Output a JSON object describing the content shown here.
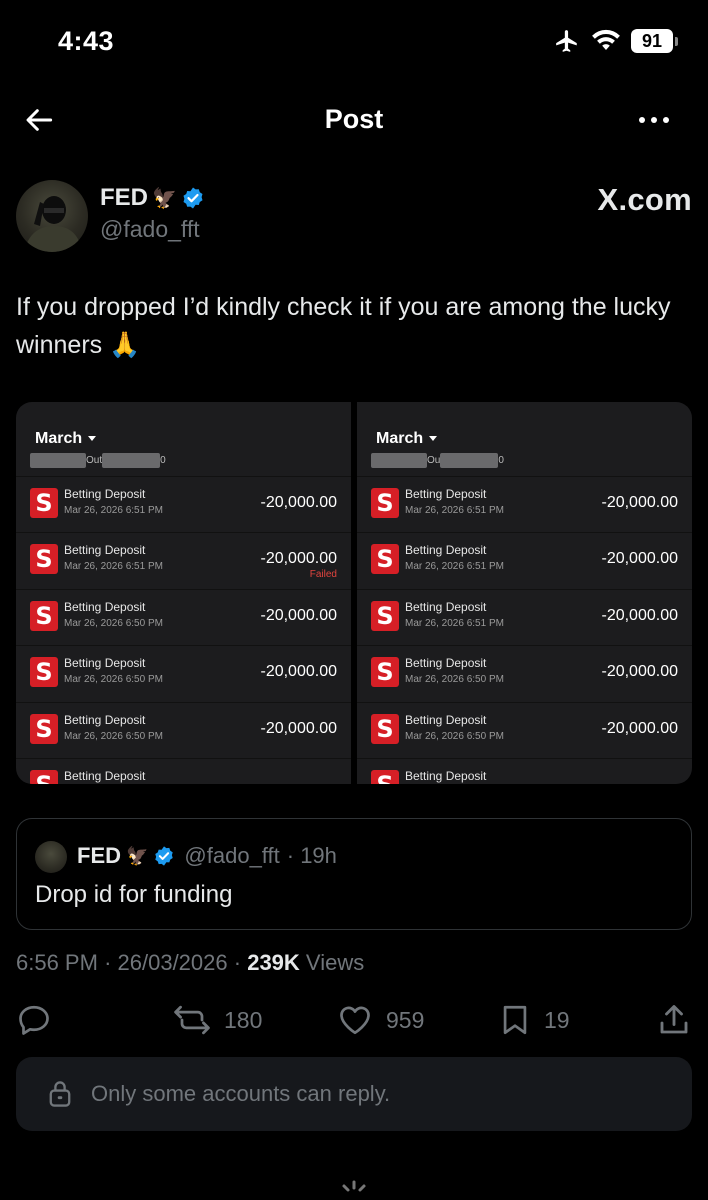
{
  "status": {
    "time": "4:43",
    "battery": "91"
  },
  "nav": {
    "title": "Post"
  },
  "author": {
    "name": "FED",
    "name_emoji": "🦅",
    "handle": "@fado_fft",
    "watermark": "X.com"
  },
  "post": {
    "text": "If you dropped I’d kindly check it if you are among the lucky winners 🙏"
  },
  "media": {
    "screenshots": [
      {
        "month": "March",
        "sub_left": "Out",
        "sub_right": "0",
        "transactions": [
          {
            "title": "Betting Deposit",
            "date": "Mar 26, 2026 6:51 PM",
            "amount": "-20,000.00",
            "status": ""
          },
          {
            "title": "Betting Deposit",
            "date": "Mar 26, 2026 6:51 PM",
            "amount": "-20,000.00",
            "status": "Failed"
          },
          {
            "title": "Betting Deposit",
            "date": "Mar 26, 2026 6:50 PM",
            "amount": "-20,000.00",
            "status": ""
          },
          {
            "title": "Betting Deposit",
            "date": "Mar 26, 2026 6:50 PM",
            "amount": "-20,000.00",
            "status": ""
          },
          {
            "title": "Betting Deposit",
            "date": "Mar 26, 2026 6:50 PM",
            "amount": "-20,000.00",
            "status": ""
          },
          {
            "title": "Betting Deposit",
            "date": "",
            "amount": "",
            "status": ""
          }
        ]
      },
      {
        "month": "March",
        "sub_left": "Ou",
        "sub_right": "0",
        "transactions": [
          {
            "title": "Betting Deposit",
            "date": "Mar 26, 2026 6:51 PM",
            "amount": "-20,000.00",
            "status": ""
          },
          {
            "title": "Betting Deposit",
            "date": "Mar 26, 2026 6:51 PM",
            "amount": "-20,000.00",
            "status": ""
          },
          {
            "title": "Betting Deposit",
            "date": "Mar 26, 2026 6:51 PM",
            "amount": "-20,000.00",
            "status": ""
          },
          {
            "title": "Betting Deposit",
            "date": "Mar 26, 2026 6:50 PM",
            "amount": "-20,000.00",
            "status": ""
          },
          {
            "title": "Betting Deposit",
            "date": "Mar 26, 2026 6:50 PM",
            "amount": "-20,000.00",
            "status": ""
          },
          {
            "title": "Betting Deposit",
            "date": "",
            "amount": "",
            "status": ""
          }
        ]
      }
    ]
  },
  "quote": {
    "name": "FED",
    "name_emoji": "🦅",
    "handle": "@fado_fft",
    "time": "· 19h",
    "text": "Drop id for funding"
  },
  "meta": {
    "time": "6:56 PM",
    "sep1": "·",
    "date": "26/03/2026",
    "sep2": "·",
    "views_count": "239K",
    "views_label": "Views"
  },
  "actions": {
    "reposts": "180",
    "likes": "959",
    "bookmarks": "19"
  },
  "reply_restriction": {
    "text": "Only some accounts can reply."
  },
  "colors": {
    "background": "#000000",
    "verified": "#1d9bf0",
    "muted": "#71767b",
    "failed": "#e0443e",
    "sportybet_red": "#d61f26"
  }
}
